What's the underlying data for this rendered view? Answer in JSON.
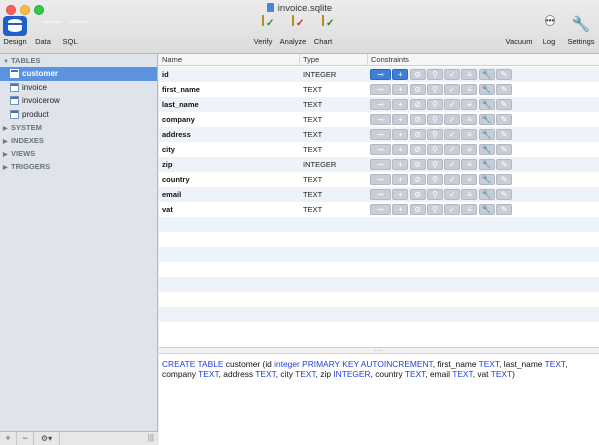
{
  "window": {
    "title": "invoice.sqlite"
  },
  "toolbar": {
    "design": "Design",
    "data": "Data",
    "sql": "SQL",
    "verify": "Verify",
    "analyze": "Analyze",
    "chart": "Chart",
    "vacuum": "Vacuum",
    "log": "Log",
    "settings": "Settings",
    "log_glyph": "•••"
  },
  "sidebar": {
    "tables_header": "TABLES",
    "tables": [
      "customer",
      "invoice",
      "invoicerow",
      "product"
    ],
    "selected_table": "customer",
    "sections": [
      "SYSTEM",
      "INDEXES",
      "VIEWS",
      "TRIGGERS"
    ],
    "footer": {
      "add": "+",
      "remove": "−",
      "gear": "⚙▾",
      "grip": "|||"
    }
  },
  "columns_header": {
    "name": "Name",
    "type": "Type",
    "constraints": "Constraints"
  },
  "columns": [
    {
      "name": "id",
      "type": "INTEGER",
      "primary_key": true
    },
    {
      "name": "first_name",
      "type": "TEXT",
      "primary_key": false
    },
    {
      "name": "last_name",
      "type": "TEXT",
      "primary_key": false
    },
    {
      "name": "company",
      "type": "TEXT",
      "primary_key": false
    },
    {
      "name": "address",
      "type": "TEXT",
      "primary_key": false
    },
    {
      "name": "city",
      "type": "TEXT",
      "primary_key": false
    },
    {
      "name": "zip",
      "type": "INTEGER",
      "primary_key": false
    },
    {
      "name": "country",
      "type": "TEXT",
      "primary_key": false
    },
    {
      "name": "email",
      "type": "TEXT",
      "primary_key": false
    },
    {
      "name": "vat",
      "type": "TEXT",
      "primary_key": false
    }
  ],
  "constraint_icons": [
    "key-icon",
    "plus-icon",
    "not-null-icon",
    "pin-icon",
    "check-icon",
    "list-icon",
    "wrench-icon",
    "edit-icon"
  ],
  "splitter_grip": ".....",
  "sql": {
    "parts": [
      {
        "t": "CREATE TABLE",
        "kw": true
      },
      {
        "t": " customer (id ",
        "kw": false
      },
      {
        "t": "integer PRIMARY KEY AUTOINCREMENT",
        "kw": true
      },
      {
        "t": ", first_name ",
        "kw": false
      },
      {
        "t": "TEXT",
        "kw": true
      },
      {
        "t": ", last_name ",
        "kw": false
      },
      {
        "t": "TEXT",
        "kw": true
      },
      {
        "t": ", company ",
        "kw": false
      },
      {
        "t": "TEXT",
        "kw": true
      },
      {
        "t": ", address ",
        "kw": false
      },
      {
        "t": "TEXT",
        "kw": true
      },
      {
        "t": ", city ",
        "kw": false
      },
      {
        "t": "TEXT",
        "kw": true
      },
      {
        "t": ", zip ",
        "kw": false
      },
      {
        "t": "INTEGER",
        "kw": true
      },
      {
        "t": ", country ",
        "kw": false
      },
      {
        "t": "TEXT",
        "kw": true
      },
      {
        "t": ", email ",
        "kw": false
      },
      {
        "t": "TEXT",
        "kw": true
      },
      {
        "t": ", vat ",
        "kw": false
      },
      {
        "t": "TEXT",
        "kw": true
      },
      {
        "t": ")",
        "kw": false
      }
    ]
  },
  "colors": {
    "accent": "#3f7fd8",
    "selection": "#5b93e0",
    "keyword": "#1f3fdf"
  }
}
